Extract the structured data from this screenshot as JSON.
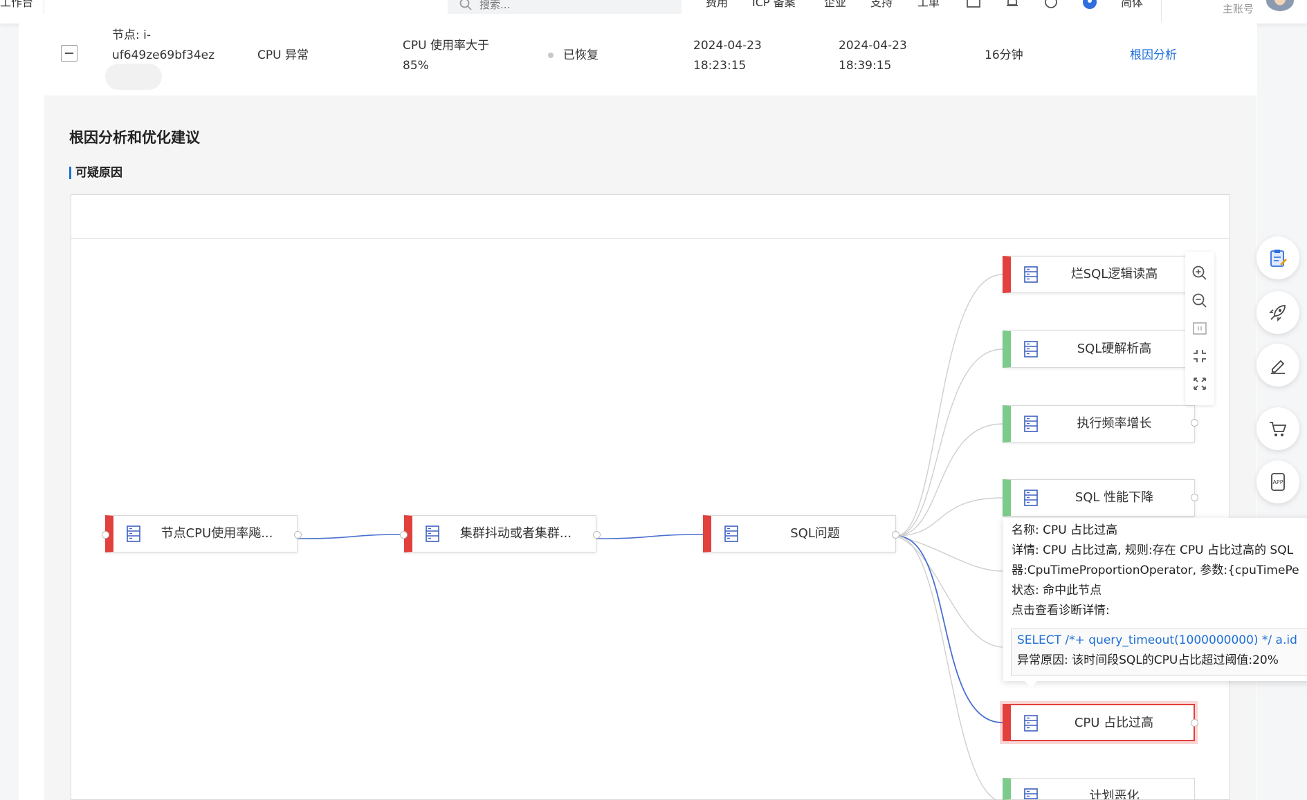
{
  "nav": {
    "left_label": "工作台",
    "search_placeholder": "搜索...",
    "links": [
      "费用",
      "ICP 备案",
      "企业",
      "支持",
      "工单",
      "简体"
    ],
    "account_label": "主账号"
  },
  "alert_row": {
    "node_line1": "节点: i-",
    "node_line2": "uf649ze69bf34ez",
    "type": "CPU 异常",
    "condition_line1": "CPU 使用率大于",
    "condition_line2": "85%",
    "status": "已恢复",
    "start_date": "2024-04-23",
    "start_time": "18:23:15",
    "end_date": "2024-04-23",
    "end_time": "18:39:15",
    "duration": "16分钟",
    "action": "根因分析"
  },
  "section": {
    "title": "根因分析和优化建议",
    "subtitle": "可疑原因"
  },
  "graph": {
    "colors": {
      "abnormal": "#e2403d",
      "normal": "#7ccb8a",
      "edge": "#cfcfcf",
      "edge_active": "#4a6fd0"
    },
    "nodes": [
      {
        "id": "n1",
        "label": "节点CPU使用率飚...",
        "state": "abnormal"
      },
      {
        "id": "n2",
        "label": "集群抖动或者集群...",
        "state": "abnormal"
      },
      {
        "id": "n3",
        "label": "SQL问题",
        "state": "abnormal"
      },
      {
        "id": "r1",
        "label": "烂SQL逻辑读高",
        "state": "abnormal"
      },
      {
        "id": "r2",
        "label": "SQL硬解析高",
        "state": "normal"
      },
      {
        "id": "r3",
        "label": "执行频率增长",
        "state": "normal"
      },
      {
        "id": "r4",
        "label": "SQL 性能下降",
        "state": "normal"
      },
      {
        "id": "r5",
        "label": "CPU 占比过高",
        "state": "abnormal"
      },
      {
        "id": "r6",
        "label": "计划恶化",
        "state": "normal"
      }
    ],
    "selected_node": "r5",
    "tooltip": {
      "name_label": "名称:",
      "name_value": "CPU 占比过高",
      "detail_label": "详情:",
      "detail_value": "CPU 占比过高, 规则:存在 CPU 占比过高的 SQL",
      "detail_line2": "器:CpuTimeProportionOperator, 参数:{cpuTimePe",
      "status_label": "状态:",
      "status_value": "命中此节点",
      "click_hint": "点击查看诊断详情:",
      "sql": "SELECT /*+ query_timeout(1000000000) */ a.id",
      "reason": "异常原因: 该时间段SQL的CPU占比超过阈值:20%"
    }
  },
  "zoom_tools": [
    "zoom-in-icon",
    "zoom-out-icon",
    "fit-view-icon",
    "collapse-view-icon",
    "fullscreen-icon"
  ],
  "float_tools": [
    "clipboard-edit-icon",
    "rocket-icon",
    "pen-icon",
    "cart-icon",
    "app-icon"
  ]
}
